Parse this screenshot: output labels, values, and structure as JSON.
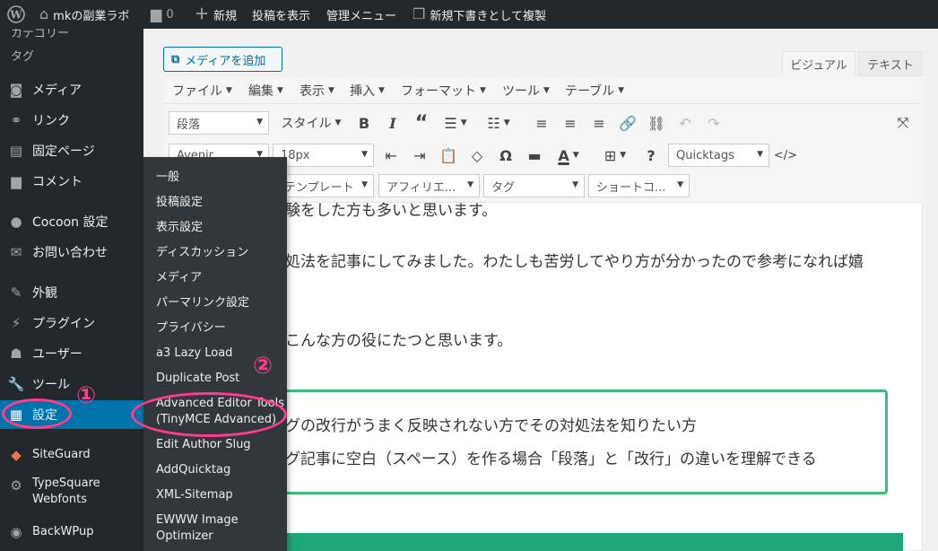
{
  "admin_bar": {
    "wp_logo_icon": "wordpress-logo",
    "site_name": "mkの副業ラボ",
    "comments_count": "0",
    "new_label": "新規",
    "view_post_label": "投稿を表示",
    "admin_menu_label": "管理メニュー",
    "duplicate_draft_label": "新規下書きとして複製"
  },
  "sidebar": {
    "items": [
      {
        "label": "カテゴリー",
        "icon": ""
      },
      {
        "label": "タグ",
        "icon": ""
      },
      {
        "label": "メディア",
        "icon": "media-icon"
      },
      {
        "label": "リンク",
        "icon": "link-icon"
      },
      {
        "label": "固定ページ",
        "icon": "page-icon"
      },
      {
        "label": "コメント",
        "icon": "comment-icon"
      },
      {
        "label": "Cocoon 設定",
        "icon": "cocoon-icon"
      },
      {
        "label": "お問い合わせ",
        "icon": "mail-icon"
      },
      {
        "label": "外観",
        "icon": "appearance-icon"
      },
      {
        "label": "プラグイン",
        "icon": "plugin-icon"
      },
      {
        "label": "ユーザー",
        "icon": "user-icon"
      },
      {
        "label": "ツール",
        "icon": "tools-icon"
      },
      {
        "label": "設定",
        "icon": "settings-icon"
      },
      {
        "label": "SiteGuard",
        "icon": "siteguard-icon"
      },
      {
        "label": "TypeSquare\nWebfonts",
        "icon": "gear-icon"
      },
      {
        "label": "BackWPup",
        "icon": "backwpup-icon"
      }
    ]
  },
  "flyout": {
    "items": [
      "一般",
      "投稿設定",
      "表示設定",
      "ディスカッション",
      "メディア",
      "パーマリンク設定",
      "プライバシー",
      "a3 Lazy Load",
      "Duplicate Post",
      "Advanced Editor Tools (TinyMCE Advanced)",
      "Edit Author Slug",
      "AddQuicktag",
      "XML-Sitemap",
      "EWWW Image Optimizer"
    ],
    "adv_line1": "Advanced Editor Tools",
    "adv_line2": "(TinyMCE Advanced)",
    "ewww_line1": "EWWW Image",
    "ewww_line2": "Optimizer"
  },
  "annotations": {
    "one": "①",
    "two": "②",
    "color": "#ff3c8e"
  },
  "editor": {
    "media_button": "メディアを追加",
    "tab_visual": "ビジュアル",
    "tab_text": "テキスト",
    "menubar": [
      "ファイル",
      "編集",
      "表示",
      "挿入",
      "フォーマット",
      "ツール",
      "テーブル"
    ],
    "paragraph_select": "段落",
    "style_menu": "スタイル",
    "font_select": "Avenir...",
    "size_select": "18px",
    "quicktags_select": "Quicktags",
    "template_select": "テンプレート",
    "affiliate_select": "アフィリエ...",
    "tag_select": "タグ",
    "shortcode_select": "ショートコ...",
    "code_label": "</>",
    "text_color_letter": "A"
  },
  "content": {
    "line1": "験をした方も多いと思います。",
    "line2": "処法を記事にしてみました。わたしも苦労してやり方が分かったので参考になれば嬉",
    "line3": "こんな方の役にたつと思います。",
    "box_line1": "グの改行がうまく反映されない方でその対処法を知りたい方",
    "box_line2": "グ記事に空白（スペース）を作る場合「段落」と「改行」の違いを理解できる",
    "box_border_color": "#3dbb7e",
    "band_color": "#20a574"
  }
}
